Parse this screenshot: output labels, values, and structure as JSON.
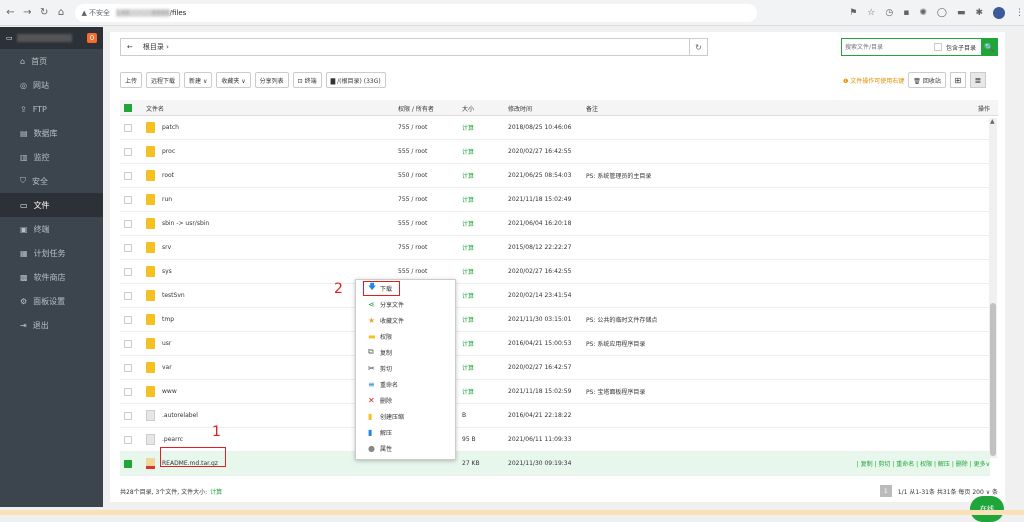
{
  "browser": {
    "security_label": "▲ 不安全",
    "url_host": "148.··.··.··:8888",
    "url_path": "/files"
  },
  "sidebar": {
    "badge": "0",
    "items": [
      {
        "icon": "home-icon",
        "glyph": "⌂",
        "label": "首页"
      },
      {
        "icon": "globe-icon",
        "glyph": "◎",
        "label": "网站"
      },
      {
        "icon": "ftp-icon",
        "glyph": "⇪",
        "label": "FTP"
      },
      {
        "icon": "database-icon",
        "glyph": "▤",
        "label": "数据库"
      },
      {
        "icon": "monitor-icon",
        "glyph": "▥",
        "label": "监控"
      },
      {
        "icon": "shield-icon",
        "glyph": "⛉",
        "label": "安全"
      },
      {
        "icon": "folder-icon",
        "glyph": "▭",
        "label": "文件"
      },
      {
        "icon": "terminal-icon",
        "glyph": "▣",
        "label": "终端"
      },
      {
        "icon": "calendar-icon",
        "glyph": "▦",
        "label": "计划任务"
      },
      {
        "icon": "store-icon",
        "glyph": "▩",
        "label": "软件商店"
      },
      {
        "icon": "gear-icon",
        "glyph": "⚙",
        "label": "面板设置"
      },
      {
        "icon": "logout-icon",
        "glyph": "⇥",
        "label": "退出"
      }
    ],
    "active_index": 6
  },
  "path": {
    "back": "←",
    "crumb": "根目录 ›",
    "refresh": "↻"
  },
  "search": {
    "placeholder": "搜索文件/目录",
    "sub_label": "包含子目录",
    "go": "🔍"
  },
  "toolbar": {
    "buttons": [
      "上传",
      "远程下载",
      "新建 ∨",
      "收藏夹 ∨",
      "分享列表",
      "⊡ 终端",
      "▇ /(根目录) (33G)"
    ],
    "tip": "❶ 文件操作可使用右键",
    "recycle": "🗑 回收站"
  },
  "table": {
    "headers": {
      "name": "文件名",
      "perm": "权限 / 所有者",
      "size": "大小",
      "mtime": "修改时间",
      "note": "备注",
      "ops": "操作"
    },
    "rows": [
      {
        "name": "patch",
        "perm": "755 / root",
        "size": "计算",
        "mtime": "2018/08/25 10:46:06",
        "note": "",
        "type": "folder"
      },
      {
        "name": "proc",
        "perm": "555 / root",
        "size": "计算",
        "mtime": "2020/02/27 16:42:55",
        "note": "",
        "type": "folder"
      },
      {
        "name": "root",
        "perm": "550 / root",
        "size": "计算",
        "mtime": "2021/06/25 08:54:03",
        "note": "PS: 系统管理员的主目录",
        "type": "folder"
      },
      {
        "name": "run",
        "perm": "755 / root",
        "size": "计算",
        "mtime": "2021/11/18 15:02:49",
        "note": "",
        "type": "folder"
      },
      {
        "name": "sbin -> usr/sbin",
        "perm": "555 / root",
        "size": "计算",
        "mtime": "2021/06/04 16:20:18",
        "note": "",
        "type": "folder"
      },
      {
        "name": "srv",
        "perm": "755 / root",
        "size": "计算",
        "mtime": "2015/08/12 22:22:27",
        "note": "",
        "type": "folder"
      },
      {
        "name": "sys",
        "perm": "555 / root",
        "size": "计算",
        "mtime": "2020/02/27 16:42:55",
        "note": "",
        "type": "folder"
      },
      {
        "name": "testSvn",
        "perm": "",
        "size": "计算",
        "mtime": "2020/02/14 23:41:54",
        "note": "",
        "type": "folder"
      },
      {
        "name": "tmp",
        "perm": "",
        "size": "计算",
        "mtime": "2021/11/30 03:15:01",
        "note": "PS: 公共的临时文件存储点",
        "type": "folder"
      },
      {
        "name": "usr",
        "perm": "",
        "size": "计算",
        "mtime": "2016/04/21 15:00:53",
        "note": "PS: 系统应用程序目录",
        "type": "folder"
      },
      {
        "name": "var",
        "perm": "",
        "size": "计算",
        "mtime": "2020/02/27 16:42:57",
        "note": "",
        "type": "folder"
      },
      {
        "name": "www",
        "perm": "",
        "size": "计算",
        "mtime": "2021/11/18 15:02:59",
        "note": "PS: 宝塔面板程序目录",
        "type": "folder"
      },
      {
        "name": ".autorelabel",
        "perm": "",
        "size": "B",
        "mtime": "2016/04/21 22:18:22",
        "note": "",
        "type": "file"
      },
      {
        "name": ".pearrc",
        "perm": "",
        "size": "95 B",
        "mtime": "2021/06/11 11:09:33",
        "note": "",
        "type": "file"
      },
      {
        "name": "README.md.tar.gz",
        "perm": "",
        "size": "27 KB",
        "mtime": "2021/11/30 09:19:34",
        "note": "",
        "type": "archive"
      }
    ],
    "selected_ops": "| 复制 | 剪切 | 重命名 | 权限 | 解压 | 删除 | 更多∨"
  },
  "context_menu": [
    {
      "icon": "download-icon",
      "glyph": "🡇",
      "label": "下载",
      "color": "#1e88e5"
    },
    {
      "icon": "share-icon",
      "glyph": "⋖",
      "label": "分享文件",
      "color": "#20a53a"
    },
    {
      "icon": "star-icon",
      "glyph": "★",
      "label": "收藏文件",
      "color": "#f5a623"
    },
    {
      "icon": "permission-icon",
      "glyph": "▬",
      "label": "权限",
      "color": "#f5c021"
    },
    {
      "icon": "copy-icon",
      "glyph": "⧉",
      "label": "复制",
      "color": "#666666"
    },
    {
      "icon": "cut-icon",
      "glyph": "✂",
      "label": "剪切",
      "color": "#333333"
    },
    {
      "icon": "rename-icon",
      "glyph": "≡",
      "label": "重命名",
      "color": "#1e88e5"
    },
    {
      "icon": "delete-icon",
      "glyph": "✕",
      "label": "删除",
      "color": "#e02020"
    },
    {
      "icon": "compress-icon",
      "glyph": "▮",
      "label": "创建压缩",
      "color": "#f5c021"
    },
    {
      "icon": "extract-icon",
      "glyph": "▮",
      "label": "解压",
      "color": "#1e88e5"
    },
    {
      "icon": "info-icon",
      "glyph": "●",
      "label": "属性",
      "color": "#888888"
    }
  ],
  "annotations": {
    "n1": "1",
    "n2": "2"
  },
  "footer": {
    "summary": "共28个目录, 3个文件, 文件大小:",
    "calc": "计算",
    "pager_current": "1",
    "pager_info": "1/1  从1-31条  共31条  每页 200 ∨ 条"
  },
  "online": "在线"
}
